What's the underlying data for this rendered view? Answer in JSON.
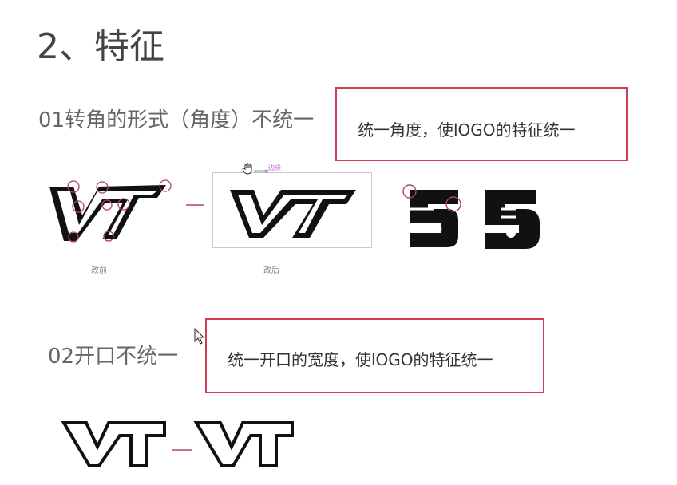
{
  "slide": {
    "title": "2、特征",
    "section1": {
      "heading": "01转角的形式（角度）不统一",
      "note": "统一角度，使lOGO的特征统一",
      "caption_before": "改前",
      "caption_after": "改后",
      "selection_tag": "边缘"
    },
    "section2": {
      "heading": "02开口不统一",
      "note": "统一开口的宽度，使lOGO的特征统一"
    },
    "logo_letters": "VT",
    "colors": {
      "accent": "#cf3b55",
      "ink": "#111111",
      "marker": "#b0455c"
    },
    "icons": [
      "hand-cursor-icon",
      "arrow-cursor-icon"
    ]
  }
}
